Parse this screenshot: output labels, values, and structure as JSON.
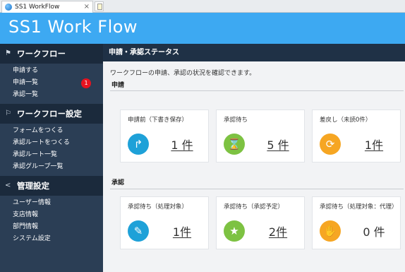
{
  "browser": {
    "tab_title": "SS1 WorkFlow",
    "tab_close": "×"
  },
  "header": {
    "logo_text": "SS1 Work Flow"
  },
  "sidebar": {
    "sections": [
      {
        "title": "ワークフロー",
        "icon": "flag-icon",
        "items": [
          {
            "label": "申請する"
          },
          {
            "label": "申請一覧",
            "badge": "1"
          },
          {
            "label": "承認一覧"
          }
        ]
      },
      {
        "title": "ワークフロー設定",
        "icon": "flag-settings-icon",
        "items": [
          {
            "label": "フォームをつくる"
          },
          {
            "label": "承認ルートをつくる"
          },
          {
            "label": "承認ルート一覧"
          },
          {
            "label": "承認グループ一覧"
          }
        ]
      },
      {
        "title": "管理設定",
        "icon": "share-icon",
        "items": [
          {
            "label": "ユーザー情報"
          },
          {
            "label": "支店情報"
          },
          {
            "label": "部門情報"
          },
          {
            "label": "システム設定"
          }
        ]
      }
    ]
  },
  "main": {
    "page_title": "申請・承認ステータス",
    "description": "ワークフローの申請、承認の状況を確認できます。",
    "groups": [
      {
        "label": "申請",
        "cards": [
          {
            "title": "申請前（下書き保存）",
            "count": "1 件",
            "icon": "redo-arrow-icon",
            "color": "#1ea1d8"
          },
          {
            "title": "承認待ち",
            "count": "5 件",
            "icon": "hourglass-icon",
            "color": "#7dc242"
          },
          {
            "title": "差戻し（未読0件）",
            "count": "1件",
            "icon": "refresh-icon",
            "color": "#f6a623"
          }
        ]
      },
      {
        "label": "承認",
        "cards": [
          {
            "title": "承認待ち（処理対象）",
            "count": "1件",
            "icon": "stamp-icon",
            "color": "#1ea1d8"
          },
          {
            "title": "承認待ち（承認予定）",
            "count": "2件",
            "icon": "star-icon",
            "color": "#7dc242"
          },
          {
            "title": "承認待ち（処理対象：代理）",
            "count": "0 件",
            "icon": "proxy-icon",
            "color": "#f6a623"
          }
        ]
      }
    ]
  }
}
